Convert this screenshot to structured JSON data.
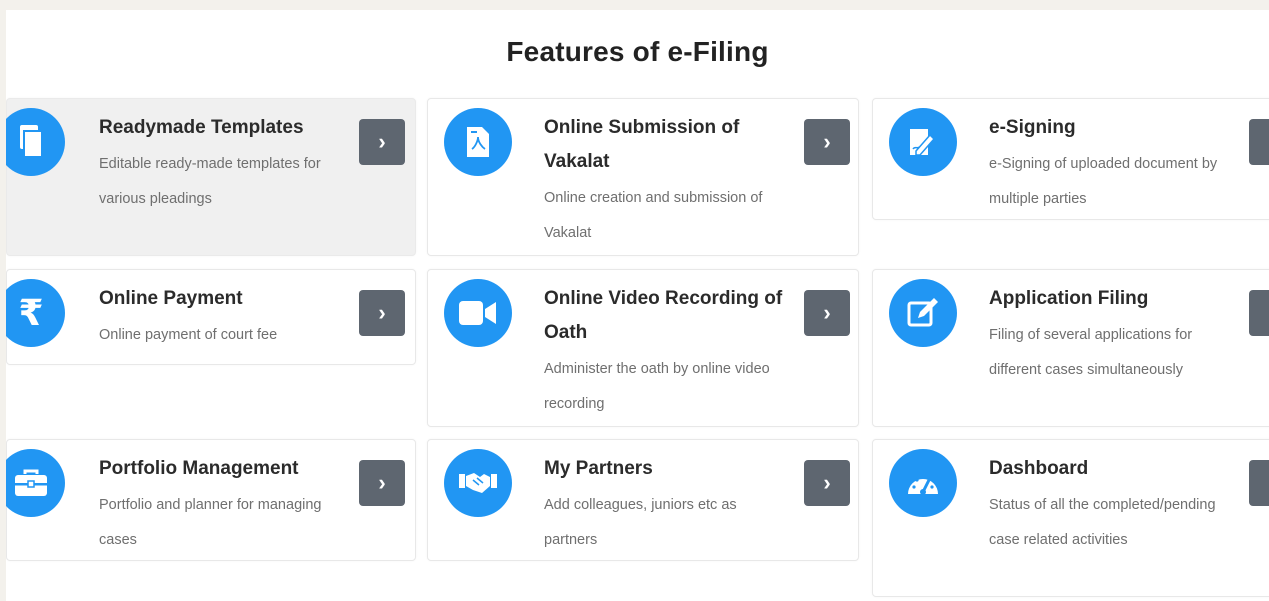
{
  "section": {
    "title": "Features of e-Filing"
  },
  "colors": {
    "icon_bg": "#2196f3",
    "arrow_bg": "#5e6670"
  },
  "features": [
    {
      "title": "Readymade Templates",
      "description": "Editable ready-made templates for various pleadings",
      "icon": "document-copy-icon"
    },
    {
      "title": "Online Submission of Vakalat",
      "description": "Online creation and submission of Vakalat",
      "icon": "pdf-file-icon"
    },
    {
      "title": "e-Signing",
      "description": "e-Signing of uploaded document by multiple parties",
      "icon": "signature-icon"
    },
    {
      "title": "Online Payment",
      "description": "Online payment of court fee",
      "icon": "rupee-icon"
    },
    {
      "title": "Online Video Recording of Oath",
      "description": "Administer the oath by online video recording",
      "icon": "video-camera-icon"
    },
    {
      "title": "Application Filing",
      "description": "Filing of several applications for different cases simultaneously",
      "icon": "edit-icon"
    },
    {
      "title": "Portfolio Management",
      "description": "Portfolio and planner for managing cases",
      "icon": "briefcase-icon"
    },
    {
      "title": "My Partners",
      "description": "Add colleagues, juniors etc as partners",
      "icon": "handshake-icon"
    },
    {
      "title": "Dashboard",
      "description": "Status of all the completed/pending case related activities",
      "icon": "dashboard-gauge-icon"
    }
  ],
  "arrow_label": "›"
}
